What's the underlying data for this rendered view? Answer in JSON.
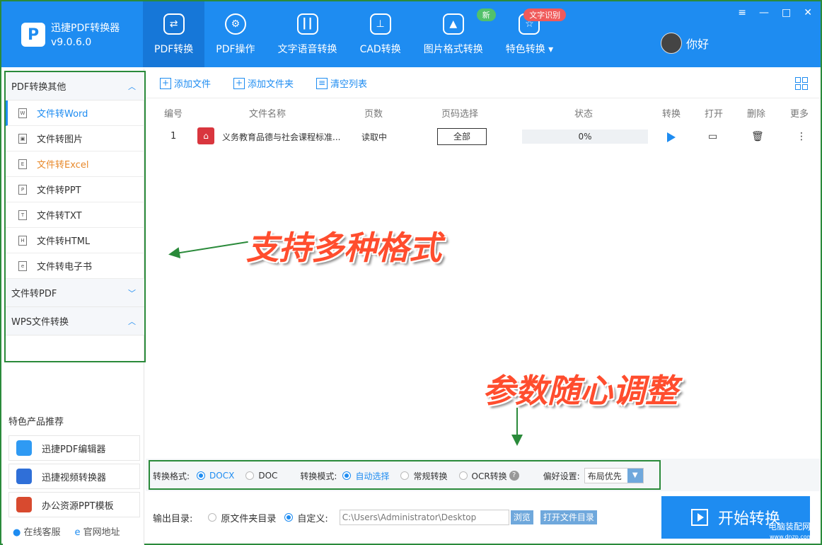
{
  "app": {
    "name": "迅捷PDF转换器",
    "version": "v9.0.6.0",
    "logo_letter": "P"
  },
  "nav": [
    {
      "label": "PDF转换",
      "icon": "pdf-convert-icon"
    },
    {
      "label": "PDF操作",
      "icon": "gear-icon"
    },
    {
      "label": "文字语音转换",
      "icon": "audio-wave-icon"
    },
    {
      "label": "CAD转换",
      "icon": "cad-icon"
    },
    {
      "label": "图片格式转换",
      "icon": "image-icon",
      "badge": "新"
    },
    {
      "label": "特色转换",
      "icon": "refresh-star-icon",
      "badge": "文字识别"
    }
  ],
  "user": {
    "name": "你好"
  },
  "window_controls": [
    "≡",
    "—",
    "□",
    "✕"
  ],
  "sidebar": {
    "group1": "PDF转换其他",
    "items": [
      "文件转Word",
      "文件转图片",
      "文件转Excel",
      "文件转PPT",
      "文件转TXT",
      "文件转HTML",
      "文件转电子书"
    ],
    "item_icons": [
      "W",
      "▣",
      "E",
      "P",
      "T",
      "H",
      "e"
    ],
    "group2": "文件转PDF",
    "group3": "WPS文件转换",
    "rec_title": "特色产品推荐",
    "rec_items": [
      "迅捷PDF编辑器",
      "迅捷视频转换器",
      "办公资源PPT模板"
    ],
    "bottom_links": [
      "在线客服",
      "官网地址"
    ]
  },
  "toolbar": {
    "add_file": "添加文件",
    "add_folder": "添加文件夹",
    "clear_list": "清空列表"
  },
  "table": {
    "headers": [
      "编号",
      "文件名称",
      "页数",
      "页码选择",
      "状态",
      "转换",
      "打开",
      "删除",
      "更多"
    ],
    "row": {
      "index": "1",
      "filename": "义务教育品德与社会课程标准...",
      "pages": "读取中",
      "page_select": "全部",
      "progress": "0%"
    }
  },
  "annotations": {
    "formats": "支持多种格式",
    "params": "参数随心调整"
  },
  "settings": {
    "format_label": "转换格式:",
    "format_opts": [
      "DOCX",
      "DOC"
    ],
    "mode_label": "转换模式:",
    "mode_opts": [
      "自动选择",
      "常规转换",
      "OCR转换"
    ],
    "pref_label": "偏好设置:",
    "pref_value": "布局优先"
  },
  "output": {
    "label": "输出目录:",
    "opt_original": "原文件夹目录",
    "opt_custom": "自定义:",
    "path": "C:\\Users\\Administrator\\Desktop",
    "browse": "浏览",
    "open_dir": "打开文件目录"
  },
  "start_button": "开始转换",
  "watermark": {
    "line1": "电脑装配网",
    "line2": "www.dnzp.com"
  },
  "colors": {
    "primary": "#1e8cf1",
    "highlight_box": "#2a8a3a",
    "callout": "#ff4d2e"
  }
}
